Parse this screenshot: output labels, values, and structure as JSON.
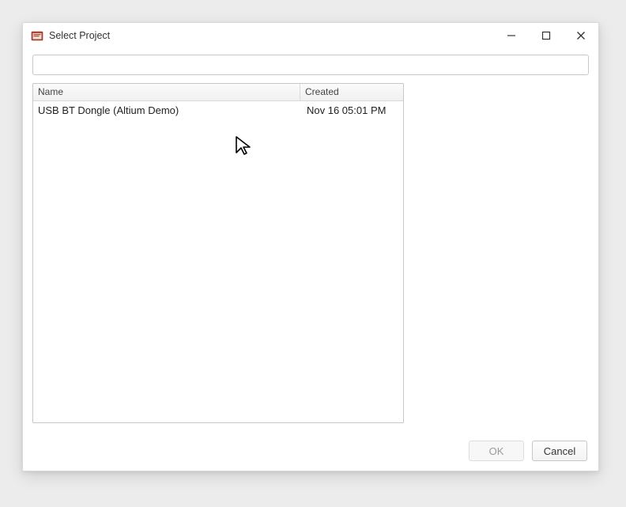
{
  "window": {
    "title": "Select Project",
    "icon": "project-icon"
  },
  "search": {
    "value": "",
    "placeholder": ""
  },
  "list": {
    "columns": {
      "name": "Name",
      "created": "Created"
    },
    "rows": [
      {
        "name": "USB BT Dongle (Altium Demo)",
        "created": "Nov 16 05:01 PM"
      }
    ]
  },
  "buttons": {
    "ok": "OK",
    "cancel": "Cancel"
  },
  "state": {
    "ok_enabled": false
  }
}
